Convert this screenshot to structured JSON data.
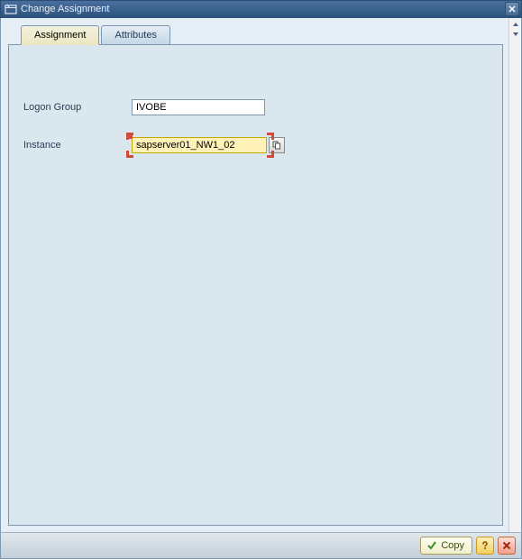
{
  "window": {
    "title": "Change Assignment"
  },
  "tabs": {
    "assignment": "Assignment",
    "attributes": "Attributes"
  },
  "form": {
    "logon_group_label": "Logon Group",
    "logon_group_value": "IVOBE",
    "instance_label": "Instance",
    "instance_value": "sapserver01_NW1_02"
  },
  "footer": {
    "copy_label": "Copy"
  }
}
